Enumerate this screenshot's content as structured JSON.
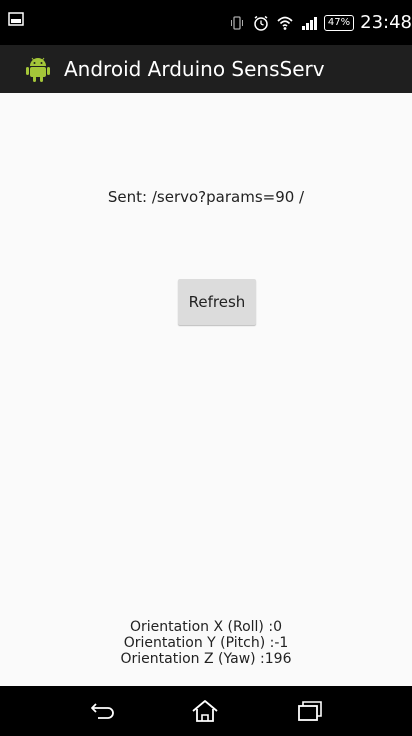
{
  "status_bar": {
    "time": "23:48",
    "battery_percent": "47%",
    "icons": [
      "screenshot-icon",
      "vibrate-icon",
      "alarm-icon",
      "wifi-icon",
      "signal-icon",
      "battery-icon"
    ]
  },
  "action_bar": {
    "title": "Android Arduino SensServ",
    "icon": "android-robot-icon"
  },
  "main": {
    "sent_text": "Sent: /servo?params=90 /",
    "refresh_label": "Refresh",
    "orientation": {
      "x": "Orientation X (Roll) :0",
      "y": "Orientation Y (Pitch) :-1",
      "z": "Orientation Z (Yaw) :196"
    }
  },
  "nav_bar": {
    "icons": [
      "back-icon",
      "home-icon",
      "recents-icon"
    ]
  },
  "colors": {
    "status_bar": "#000000",
    "action_bar": "#1f1f1f",
    "background": "#fafafa",
    "button": "#dcdcdc",
    "android_green": "#a4c639"
  }
}
